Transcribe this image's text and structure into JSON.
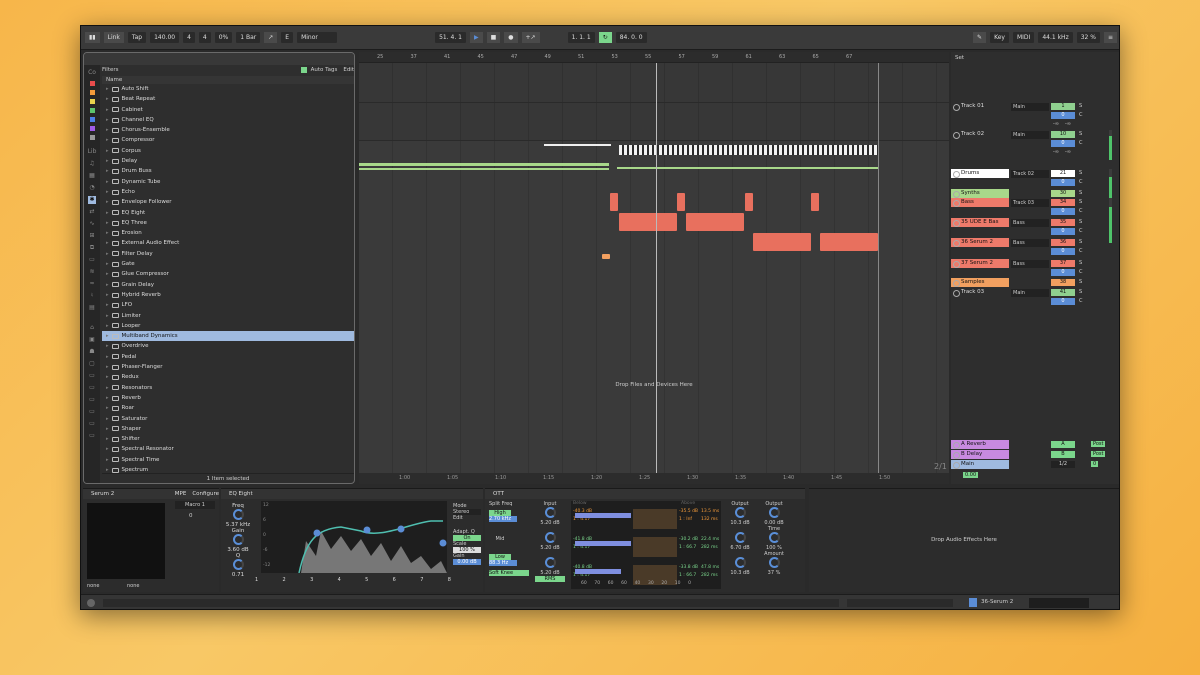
{
  "toolbar": {
    "link": "Link",
    "tap": "Tap",
    "tempo": "140.00",
    "sig_num": "4",
    "sig_den": "4",
    "groove": "0%",
    "quant": "1 Bar",
    "key": "E",
    "scale": "Minor",
    "pos1": "51. 4. 1",
    "pos2": "1. 1. 1",
    "pos3": "84. 0. 0",
    "key_btn": "Key",
    "midi_btn": "MIDI",
    "sr": "44.1 kHz",
    "cpu": "32 %"
  },
  "browser": {
    "filters": "Filters",
    "auto_tags": "Auto Tags",
    "edit": "Edit",
    "col": "Name",
    "footer": "1 Item selected",
    "side": [
      "Co",
      "Lib"
    ],
    "items": [
      "Auto Shift",
      "Beat Repeat",
      "Cabinet",
      "Channel EQ",
      "Chorus-Ensemble",
      "Compressor",
      "Corpus",
      "Delay",
      "Drum Buss",
      "Dynamic Tube",
      "Echo",
      "Envelope Follower",
      "EQ Eight",
      "EQ Three",
      "Erosion",
      "External Audio Effect",
      "Filter Delay",
      "Gate",
      "Glue Compressor",
      "Grain Delay",
      "Hybrid Reverb",
      "LFO",
      "Limiter",
      "Looper",
      "Multiband Dynamics",
      "Overdrive",
      "Pedal",
      "Phaser-Flanger",
      "Redux",
      "Resonators",
      "Reverb",
      "Roar",
      "Saturator",
      "Shaper",
      "Shifter",
      "Spectral Resonator",
      "Spectral Time",
      "Spectrum"
    ],
    "selected": "Multiband Dynamics"
  },
  "arrangement": {
    "bars": [
      "25",
      "37",
      "41",
      "45",
      "47",
      "49",
      "51",
      "53",
      "55",
      "57",
      "59",
      "61",
      "63",
      "65",
      "67"
    ],
    "times": [
      "1:00",
      "1:05",
      "1:10",
      "1:15",
      "1:20",
      "1:25",
      "1:30",
      "1:35",
      "1:40",
      "1:45",
      "1:50"
    ],
    "drop_text": "Drop Files and Devices Here",
    "page": "2/1",
    "set": "Set"
  },
  "mixer": {
    "tracks": [
      {
        "name": "Track 01",
        "io": "Main",
        "vol": "1",
        "pan": "0",
        "send": "-∞",
        "color": "#8fd08f"
      },
      {
        "name": "Track 02",
        "io": "Main",
        "vol": "10",
        "pan": "0",
        "send": "-∞",
        "color": "#8fd08f"
      },
      {
        "name": "Drums",
        "io": "Track 02",
        "vol": "21",
        "pan": "0",
        "send": "",
        "color": "#ffffff"
      },
      {
        "name": "Synths",
        "io": "",
        "vol": "30",
        "pan": "",
        "send": "",
        "color": "#a8d88a"
      },
      {
        "name": "Bass",
        "io": "Track 03",
        "vol": "34",
        "pan": "0",
        "send": "",
        "color": "#ee7a6a"
      },
      {
        "name": "35 UDE E Bas",
        "io": "Bass",
        "vol": "35",
        "pan": "0",
        "send": "",
        "color": "#ee7a6a"
      },
      {
        "name": "36 Serum 2",
        "io": "Bass",
        "vol": "36",
        "pan": "0",
        "send": "",
        "color": "#ee7a6a"
      },
      {
        "name": "37 Serum 2",
        "io": "Bass",
        "vol": "37",
        "pan": "0",
        "send": "",
        "color": "#ee7a6a"
      },
      {
        "name": "Samples",
        "io": "",
        "vol": "38",
        "pan": "",
        "send": "",
        "color": "#f2a060"
      },
      {
        "name": "Track 03",
        "io": "Main",
        "vol": "41",
        "pan": "0",
        "send": "",
        "color": "#8fd08f"
      }
    ],
    "returns": [
      {
        "name": "A Reverb",
        "letter": "A",
        "post": "Post"
      },
      {
        "name": "B Delay",
        "letter": "B",
        "post": "Post"
      },
      {
        "name": "Main",
        "letter": "1/2",
        "post": "0"
      }
    ],
    "main_vol": "0.00"
  },
  "devices": {
    "serum": {
      "title": "Serum 2",
      "mpe": "MPE",
      "configure": "Configure",
      "macro": "Macro 1",
      "macro_val": "0",
      "none1": "none",
      "none2": "none"
    },
    "eq": {
      "title": "EQ Eight",
      "freq": "Freq",
      "freq_val": "5.37 kHz",
      "gain": "Gain",
      "gain_val": "3.60 dB",
      "q": "Q",
      "q_val": "0.71",
      "mode": "Mode",
      "mode_val": "Stereo",
      "edit": "Edit",
      "adapt": "Adapt. Q",
      "adapt_val": "On",
      "scale": "Scale",
      "scale_val": "100 %",
      "out_gain": "Gain",
      "out_val": "0.00 dB",
      "bands": [
        "1",
        "2",
        "3",
        "4",
        "5",
        "6",
        "7",
        "8"
      ],
      "ylabels": [
        "12",
        "6",
        "0",
        "-6",
        "-12"
      ]
    },
    "ott": {
      "title": "OTT",
      "split": "Split Freq",
      "high": "High",
      "high_val": "2.70 kHz",
      "mid": "Mid",
      "low": "Low",
      "low_val": "88.3 Hz",
      "soft": "Soft Knee",
      "rms": "RMS",
      "input": "Input",
      "in1": "5.20 dB",
      "in2": "5.20 dB",
      "in3": "5.20 dB",
      "below": "Below",
      "above": "Above",
      "att": "Att/Rel",
      "output": "Output",
      "o1": "10.3 dB",
      "o2": "6.70 dB",
      "o3": "10.3 dB",
      "out2": "Output",
      "out2_val": "0.00 dB",
      "time": "Time",
      "time_val": "100 %",
      "amount": "Amount",
      "amount_val": "37 %",
      "b1": [
        "-40.3 dB",
        "1 : 4.17",
        "-35.5 dB",
        "1 : Inf",
        "13.5 ms",
        "132 ms"
      ],
      "b2": [
        "-41.8 dB",
        "1 : 4.17",
        "-30.2 dB",
        "1 : 66.7",
        "22.4 ms",
        "282 ms"
      ],
      "b3": [
        "-40.8 dB",
        "1 : 4.17",
        "-33.8 dB",
        "1 : 66.7",
        "47.8 ms",
        "282 ms"
      ],
      "scale": [
        "60",
        "70",
        "60",
        "60",
        "40",
        "30",
        "20",
        "10",
        "0"
      ]
    },
    "drop": "Drop Audio Effects Here"
  },
  "status": {
    "track": "36-Serum 2"
  },
  "colors": {
    "bass_clip": "#e8705e",
    "synth_clip": "#a8d88a",
    "selection": "#9fbadf",
    "accent": "#5b8dd6"
  }
}
